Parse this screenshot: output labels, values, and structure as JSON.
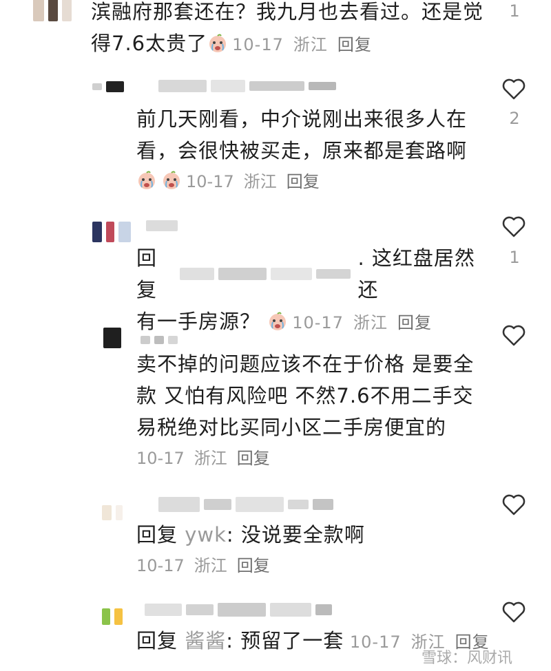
{
  "comments": [
    {
      "text_line1": "滨融府那套还在？我九月也去看过。还是觉",
      "text_line2": "得7.6太贵了",
      "date": "10-17",
      "location": "浙江",
      "reply_label": "回复",
      "likes": "1"
    },
    {
      "text_line1": "前几天刚看，中介说刚出来很多人在",
      "text_line2": "看，会很快被买走，原来都是套路啊",
      "date": "10-17",
      "location": "浙江",
      "reply_label": "回复",
      "likes": "2"
    },
    {
      "prefix": "回复",
      "text_line1_tail": ". 这红盘居然还",
      "text_line2": "有一手房源？",
      "date": "10-17",
      "location": "浙江",
      "reply_label": "回复",
      "likes": "1"
    },
    {
      "text_line1": "卖不掉的问题应该不在于价格 是要全",
      "text_line2": "款 又怕有风险吧 不然7.6不用二手交",
      "text_line3": "易税绝对比买同小区二手房便宜的",
      "date": "10-17",
      "location": "浙江",
      "reply_label": "回复"
    },
    {
      "prefix": "回复",
      "mention": "ywk",
      "text": ": 没说要全款啊",
      "date": "10-17",
      "location": "浙江",
      "reply_label": "回复"
    },
    {
      "prefix": "回复",
      "mention": "酱酱",
      "text": ": 预留了一套",
      "date": "10-17",
      "location": "浙江",
      "reply_label": "回复"
    }
  ],
  "watermark": "雪球：风财讯",
  "icons": {
    "like": "heart-outline-icon",
    "emoji": "crying-face-emoji"
  }
}
